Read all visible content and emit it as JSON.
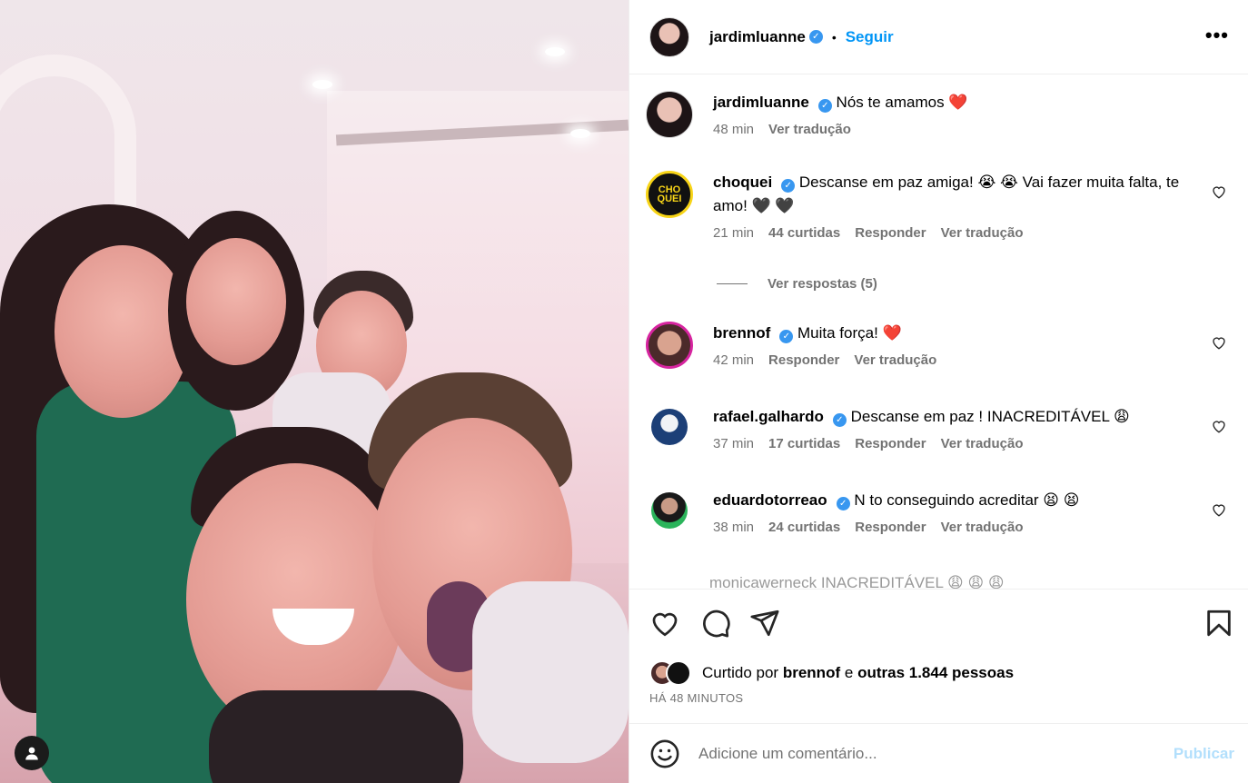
{
  "post": {
    "username": "jardimluanne",
    "dot": "•",
    "follow_label": "Seguir",
    "more_label": "•••"
  },
  "caption": {
    "username": "jardimluanne",
    "text": "Nós te amamos",
    "emoji": "❤️",
    "time": "48 min",
    "translate": "Ver tradução"
  },
  "comments": [
    {
      "username": "choquei",
      "text": "Descanse em paz amiga! 😭 😭 Vai fazer muita falta, te amo! 🖤 🖤",
      "time": "21 min",
      "likes": "44 curtidas",
      "reply": "Responder",
      "translate": "Ver tradução",
      "avatar_text": "CHO QUEI"
    },
    {
      "username": "brennof",
      "text": "Muita força! ❤️",
      "time": "42 min",
      "reply": "Responder",
      "translate": "Ver tradução"
    },
    {
      "username": "rafael.galhardo",
      "text": "Descanse em paz ! INACREDITÁVEL 😩",
      "time": "37 min",
      "likes": "17 curtidas",
      "reply": "Responder",
      "translate": "Ver tradução"
    },
    {
      "username": "eduardotorreao",
      "text": "N to conseguindo acreditar 😫 😫",
      "time": "38 min",
      "likes": "24 curtidas",
      "reply": "Responder",
      "translate": "Ver tradução"
    }
  ],
  "view_replies": "Ver respostas (5)",
  "partial_comment": "monicawerneck INACREDITÁVEL 😩 😩 😩",
  "likes_line": {
    "prefix": "Curtido por",
    "user": "brennof",
    "middle": "e",
    "others": "outras 1.844 pessoas"
  },
  "time_ago": "HÁ 48 MINUTOS",
  "comment_input": {
    "placeholder": "Adicione um comentário..."
  },
  "publish_label": "Publicar",
  "colors": {
    "accent": "#0095f6",
    "verified": "#3897f0",
    "muted": "#737373",
    "publish_disabled": "#b2dffc"
  }
}
